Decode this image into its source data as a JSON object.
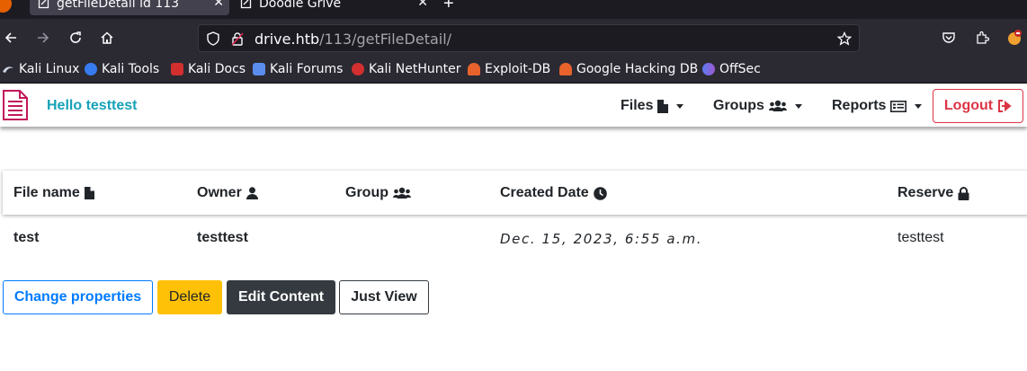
{
  "browser": {
    "tabs": [
      {
        "title": "getFileDetail id 113",
        "active": true
      },
      {
        "title": "Doodle Grive",
        "active": false
      }
    ],
    "url": {
      "host": "drive.htb",
      "path": "/113/getFileDetail/"
    },
    "bookmarks": [
      {
        "label": "Kali Linux",
        "icon": "kali-icon",
        "color": "#367bf0"
      },
      {
        "label": "Kali Tools",
        "icon": "kali-tools-icon",
        "color": "#4e8cf4"
      },
      {
        "label": "Kali Docs",
        "icon": "kali-docs-icon",
        "color": "#d32f2f"
      },
      {
        "label": "Kali Forums",
        "icon": "kali-forums-icon",
        "color": "#5b8def"
      },
      {
        "label": "Kali NetHunter",
        "icon": "nethunter-icon",
        "color": "#d32f2f"
      },
      {
        "label": "Exploit-DB",
        "icon": "exploit-db-icon",
        "color": "#e8632b"
      },
      {
        "label": "Google Hacking DB",
        "icon": "ghdb-icon",
        "color": "#e8632b"
      },
      {
        "label": "OffSec",
        "icon": "offsec-icon",
        "color": "#5b7cf0"
      }
    ]
  },
  "site": {
    "greeting": "Hello testtest",
    "menu": {
      "files": "Files",
      "groups": "Groups",
      "reports": "Reports",
      "logout": "Logout"
    }
  },
  "table": {
    "headers": {
      "file_name": "File name",
      "owner": "Owner",
      "group": "Group",
      "created_date": "Created Date",
      "reserve": "Reserve"
    },
    "row": {
      "file_name": "test",
      "owner": "testtest",
      "group": "",
      "created_date": "Dec. 15, 2023, 6:55 a.m.",
      "reserve": "testtest"
    }
  },
  "actions": {
    "change_properties": "Change properties",
    "delete": "Delete",
    "edit_content": "Edit Content",
    "just_view": "Just View"
  },
  "colors": {
    "accent_info": "#17a2b8",
    "danger": "#dc3545",
    "primary": "#007bff",
    "warning": "#ffc107",
    "dark": "#343a40"
  }
}
